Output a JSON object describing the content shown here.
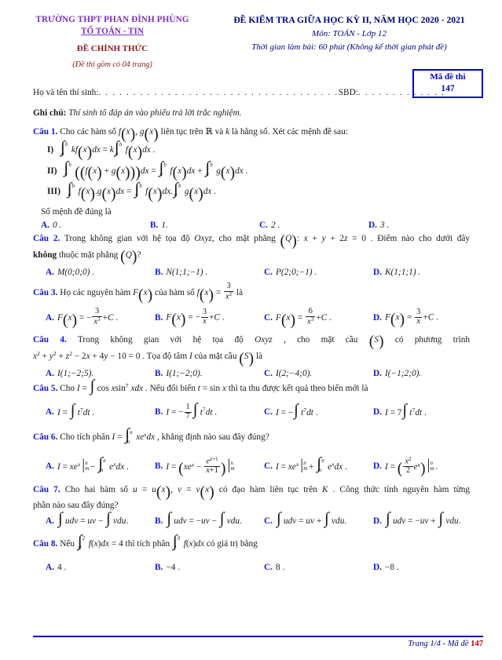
{
  "header": {
    "school": "TRƯỜNG THPT PHAN ĐÌNH PHÙNG",
    "department": "TỔ TOÁN - TIN",
    "official": "ĐỀ CHÍNH THỨC",
    "pages_note": "(Đề thi gồm có 04 trang)",
    "exam_title": "ĐỀ KIỂM TRA GIỮA HỌC KỲ II, NĂM HỌC 2020 - 2021",
    "subject": "Môn: TOÁN - Lớp 12",
    "duration": "Thời gian làm bài: 60 phút (Không kể thời gian phát đề)",
    "code_label": "Mã đề thi",
    "code_value": "147",
    "name_label": "Họ và tên thí sinh:",
    "sbd_label": "SBD:",
    "name_dots": ". . . . . . . . . . . . . . . . . . . . . . . . . . . . . . . . . . .",
    "sbd_dots": ". . . . . . . . . . . . ."
  },
  "note": {
    "prefix": "Ghi chú:",
    "text": "Thí sinh tô đáp án vào phiếu trả lời trắc nghiệm."
  },
  "questions": [
    {
      "label": "Câu 1.",
      "text": "Cho các hàm số f(x), g(x) liên tục trên ℝ và k là hằng số. Xét các mệnh đề sau:",
      "statements": [
        {
          "roman": "I)",
          "formula": "∫ₐᵇ kf(x)dx = k∫ₐᵇ f(x)dx ."
        },
        {
          "roman": "II)",
          "formula": "∫ₐᵇ (f(x)+g(x))dx = ∫ₐᵇ f(x)dx + ∫ₐᵇ g(x)dx ."
        },
        {
          "roman": "III)",
          "formula": "∫ₐᵇ f(x).g(x)dx = ∫ₐᵇ f(x)dx.∫ₐᵇ g(x)dx ."
        }
      ],
      "subprompt": "Số mệnh đề đúng là",
      "options": [
        {
          "label": "A.",
          "text": "0 ."
        },
        {
          "label": "B.",
          "text": "1."
        },
        {
          "label": "C.",
          "text": "2 ."
        },
        {
          "label": "D.",
          "text": "3 ."
        }
      ]
    },
    {
      "label": "Câu 2.",
      "text": "Trong không gian với hệ tọa độ Oxyz, cho mặt phẳng (Q): x + y + 2z = 0 . Điểm nào cho dưới đây không thuộc mặt phẳng (Q)?",
      "options": [
        {
          "label": "A.",
          "text": "M(0;0;0) ."
        },
        {
          "label": "B.",
          "text": "N(1;1;−1) ."
        },
        {
          "label": "C.",
          "text": "P(2;0;−1) ."
        },
        {
          "label": "D.",
          "text": "K(1;1;1) ."
        }
      ]
    },
    {
      "label": "Câu 3.",
      "text": "Họ các nguyên hàm F(x) của hàm số f(x) = 3/x² là",
      "options": [
        {
          "label": "A.",
          "text": "F(x) = −3/x³ + C ."
        },
        {
          "label": "B.",
          "text": "F(x) = −3/x + C ."
        },
        {
          "label": "C.",
          "text": "F(x) = 6/x³ + C ."
        },
        {
          "label": "D.",
          "text": "F(x) = 3/x + C ."
        }
      ]
    },
    {
      "label": "Câu 4.",
      "text": "Trong không gian với hệ tọa độ Oxyz, cho mặt cầu (S) có phương trình x² + y² + z² − 2x + 4y − 10 = 0 . Tọa độ tâm I của mặt cầu (S) là",
      "options": [
        {
          "label": "A.",
          "text": "I(1;−2;5)."
        },
        {
          "label": "B.",
          "text": "I(1;−2;0)."
        },
        {
          "label": "C.",
          "text": "I(2;−4;0)."
        },
        {
          "label": "D.",
          "text": "I(−1;2;0)."
        }
      ]
    },
    {
      "label": "Câu 5.",
      "text": "Cho I = ∫cos x sin⁷ x dx . Nếu đổi biến t = sin x thì ta thu được kết quả theo biến mới là",
      "options": [
        {
          "label": "A.",
          "text": "I = ∫t⁷dt ."
        },
        {
          "label": "B.",
          "text": "I = −(1/7)∫t⁷dt ."
        },
        {
          "label": "C.",
          "text": "I = −∫t⁷dt ."
        },
        {
          "label": "D.",
          "text": "I = 7∫t⁷dt ."
        }
      ]
    },
    {
      "label": "Câu 6.",
      "text": "Cho tích phân I = ∫ₘⁿ xeˣdx , khẳng định nào sau đây đúng?",
      "options": [
        {
          "label": "A.",
          "text": "I = xeˣ|ₘⁿ − ∫ₘⁿ eˣdx ."
        },
        {
          "label": "B.",
          "text": "I = (xeˣ − eˣ⁺¹/(x+1))|ₘⁿ"
        },
        {
          "label": "C.",
          "text": "I = xeˣ|ₘⁿ + ∫ₘⁿ eˣdx ."
        },
        {
          "label": "D.",
          "text": "I = (x²/2 · eˣ)|ₘⁿ ."
        }
      ]
    },
    {
      "label": "Câu 7.",
      "text": "Cho hai hàm số u = u(x), v = v(x) có đạo hàm liên tục trên K . Công thức tính nguyên hàm từng phần nào sau đây đúng?",
      "options": [
        {
          "label": "A.",
          "text": "∫udv = uv − ∫vdu."
        },
        {
          "label": "B.",
          "text": "∫udv = −uv − ∫vdu."
        },
        {
          "label": "C.",
          "text": "∫udv = uv + ∫vdu."
        },
        {
          "label": "D.",
          "text": "∫udv = −uv + ∫vdu."
        }
      ]
    },
    {
      "label": "Câu 8.",
      "text": "Nếu ∫₀² f(x)dx = 4 thì tích phân ∫₂⁰ f(x)dx có giá trị bằng",
      "options": [
        {
          "label": "A.",
          "text": "4 ."
        },
        {
          "label": "B.",
          "text": "−4 ."
        },
        {
          "label": "C.",
          "text": "8 ."
        },
        {
          "label": "D.",
          "text": "−8 ."
        }
      ]
    }
  ],
  "footer": {
    "text": "Trang 1/4 - Mã đề ",
    "code": "147"
  },
  "colors": {
    "school_purple": "#7b2fbe",
    "official_red": "#8d1919",
    "exam_blue": "#00007f",
    "question_blue": "#1414d2",
    "code_blue": "#0000c8",
    "footer_red": "#c00000"
  }
}
